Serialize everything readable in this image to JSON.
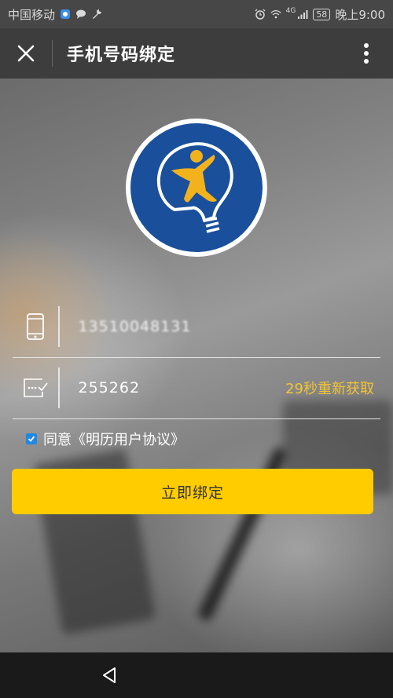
{
  "status_bar": {
    "carrier": "中国移动",
    "signal_type": "4G",
    "battery": "58",
    "time": "晚上9:00"
  },
  "nav": {
    "title": "手机号码绑定",
    "close_icon": "close-icon",
    "more_icon": "more-vertical-icon"
  },
  "form": {
    "phone_value": "13510048131",
    "code_value": "255262",
    "resend_label": "29秒重新获取",
    "agree_label": "同意《明历用户协议》",
    "agree_checked": true,
    "submit_label": "立即绑定"
  },
  "colors": {
    "accent_yellow": "#ffcc00",
    "resend_text": "#f2c437",
    "checkbox_blue": "#1e88e5",
    "logo_blue": "#1a4f9c"
  },
  "system_nav": {
    "back_icon": "back-triangle-icon"
  }
}
